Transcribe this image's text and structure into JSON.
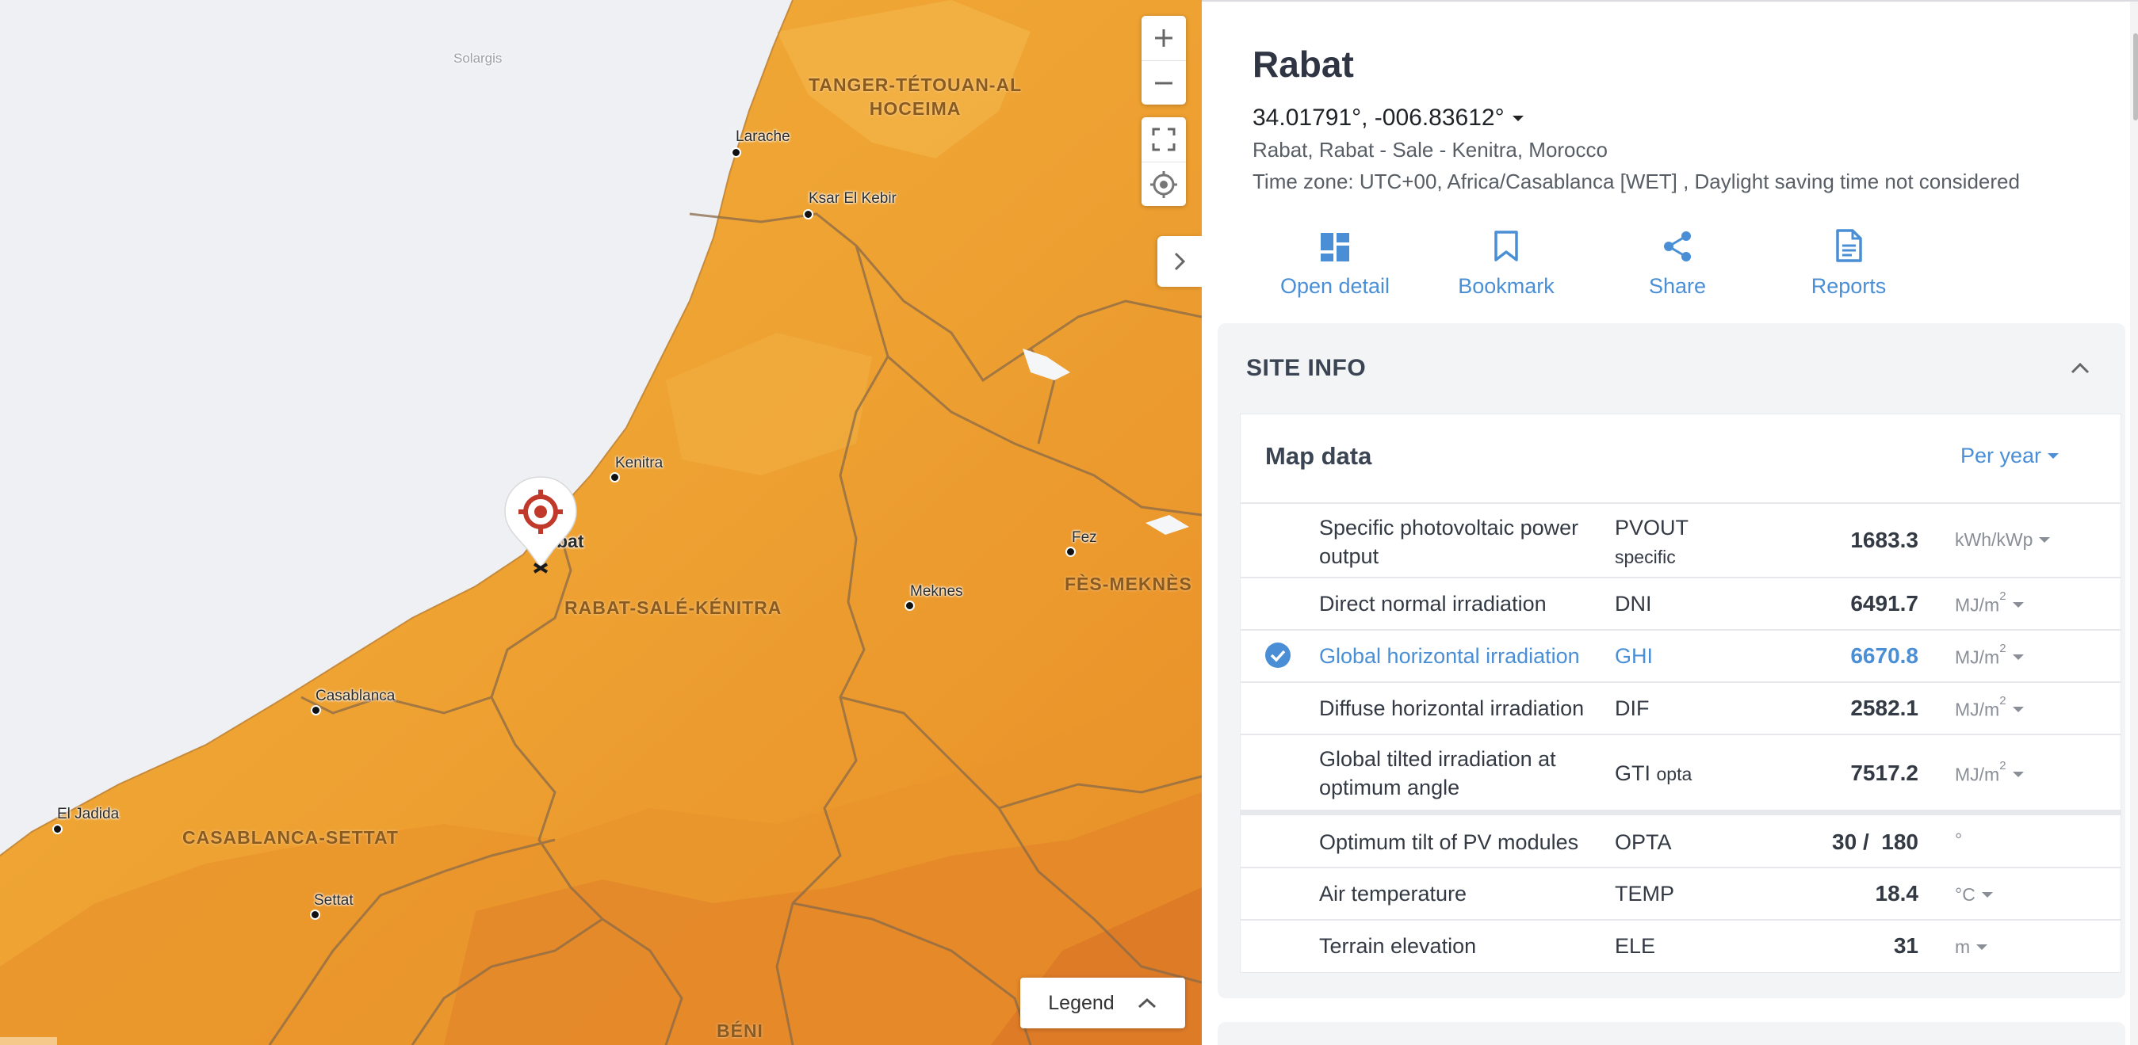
{
  "map": {
    "attribution": "Solargis",
    "regions": [
      {
        "id": "tanger",
        "line1": "TANGER-TÉTOUAN-AL",
        "line2": "HOCEIMA"
      },
      {
        "id": "rabat",
        "line1": "RABAT-SALÉ-KÉNITRA"
      },
      {
        "id": "fes",
        "line1": "FÈS-MEKNÈS"
      },
      {
        "id": "casa",
        "line1": "CASABLANCA-SETTAT"
      },
      {
        "id": "beni",
        "line1": "BÉNI"
      }
    ],
    "cities": {
      "larache": "Larache",
      "ksar": "Ksar El Kebir",
      "kenitra": "Kenitra",
      "rabat": "bat",
      "fez": "Fez",
      "meknes": "Meknes",
      "casablanca": "Casablanca",
      "eljadida": "El Jadida",
      "settat": "Settat"
    },
    "legend_label": "Legend",
    "colors": {
      "sea": "#eef0f3",
      "land_base": "#f0a531",
      "land_dark": "#e88a22",
      "border": "#8a6a48"
    }
  },
  "site": {
    "title": "Rabat",
    "coordinates": "34.01791°, -006.83612°",
    "address": "Rabat, Rabat - Sale - Kenitra, Morocco",
    "timezone": "Time zone: UTC+00, Africa/Casablanca [WET] , Daylight saving time not considered"
  },
  "actions": {
    "open_detail": "Open detail",
    "bookmark": "Bookmark",
    "share": "Share",
    "reports": "Reports"
  },
  "site_info": {
    "title": "SITE INFO",
    "map_data_title": "Map data",
    "period": "Per year",
    "rows": [
      {
        "name": "Specific photovoltaic power output",
        "abbr": "PVOUT",
        "abbr_sub": "specific",
        "value": "1683.3",
        "unit": "kWh/kWp",
        "unit_sup": ""
      },
      {
        "name": "Direct normal irradiation",
        "abbr": "DNI",
        "abbr_sub": "",
        "value": "6491.7",
        "unit": "MJ/m",
        "unit_sup": "2"
      },
      {
        "name": "Global horizontal irradiation",
        "abbr": "GHI",
        "abbr_sub": "",
        "value": "6670.8",
        "unit": "MJ/m",
        "unit_sup": "2"
      },
      {
        "name": "Diffuse horizontal irradiation",
        "abbr": "DIF",
        "abbr_sub": "",
        "value": "2582.1",
        "unit": "MJ/m",
        "unit_sup": "2"
      },
      {
        "name": "Global tilted irradiation at optimum angle",
        "abbr": "GTI",
        "abbr_sub": "opta",
        "value": "7517.2",
        "unit": "MJ/m",
        "unit_sup": "2"
      },
      {
        "name": "Optimum tilt of PV modules",
        "abbr": "OPTA",
        "abbr_sub": "",
        "value": "30 /  180",
        "unit": "°",
        "unit_sup": ""
      },
      {
        "name": "Air temperature",
        "abbr": "TEMP",
        "abbr_sub": "",
        "value": "18.4",
        "unit": "°C",
        "unit_sup": ""
      },
      {
        "name": "Terrain elevation",
        "abbr": "ELE",
        "abbr_sub": "",
        "value": "31",
        "unit": "m",
        "unit_sup": ""
      }
    ],
    "accent_color": "#4a8fd6"
  }
}
